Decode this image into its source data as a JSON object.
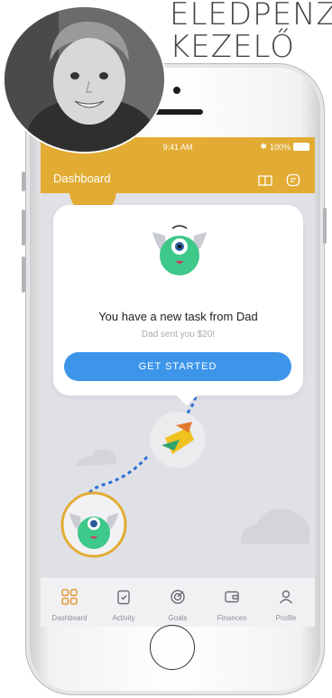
{
  "headline": {
    "line1": "ELEDPÉNZ",
    "line2": "KEZELŐ"
  },
  "status_bar": {
    "time": "9:41 AM",
    "battery": "100%"
  },
  "app_bar": {
    "title": "Dashboard",
    "book_icon": "book-icon",
    "chat_icon": "chat-icon"
  },
  "popup": {
    "message": "You have a new task from Dad",
    "subtitle": "Dad sent you $20!",
    "cta_label": "GET STARTED"
  },
  "tabs": [
    {
      "label": "Dashboard",
      "icon": "grid-icon",
      "active": true
    },
    {
      "label": "Activity",
      "icon": "clipboard-check-icon",
      "active": false
    },
    {
      "label": "Goals",
      "icon": "target-icon",
      "active": false
    },
    {
      "label": "Finances",
      "icon": "wallet-icon",
      "active": false
    },
    {
      "label": "Profile",
      "icon": "person-icon",
      "active": false
    }
  ],
  "colors": {
    "brand_yellow": "#e2ac34",
    "cta_blue": "#3d95ea",
    "active_tab": "#e89a3c",
    "monster_green": "#3ec88a"
  }
}
